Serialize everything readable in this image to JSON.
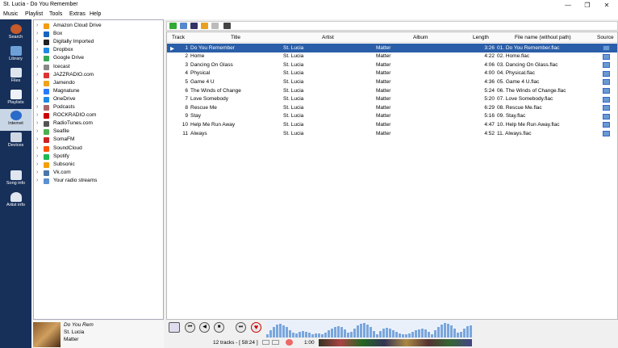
{
  "window": {
    "title": "St. Lucia - Do You Remember",
    "minimize": "—",
    "maximize": "❐",
    "close": "✕"
  },
  "menu": [
    "Music",
    "Playlist",
    "Tools",
    "Extras",
    "Help"
  ],
  "nav": [
    {
      "label": "Search"
    },
    {
      "label": "Library"
    },
    {
      "label": "Files"
    },
    {
      "label": "Playlists"
    },
    {
      "label": "Internet"
    },
    {
      "label": "Devices"
    },
    {
      "label": "Song info"
    },
    {
      "label": "Artist info"
    }
  ],
  "services": [
    "Amazon Cloud Drive",
    "Box",
    "Digitally Imported",
    "Dropbox",
    "Google Drive",
    "Icecast",
    "JAZZRADIO.com",
    "Jamendo",
    "Magnatune",
    "OneDrive",
    "Podcasts",
    "ROCKRADIO.com",
    "RadioTunes.com",
    "Seafile",
    "SomaFM",
    "SoundCloud",
    "Spotify",
    "Subsonic",
    "Vk.com",
    "Your radio streams"
  ],
  "service_icon_colors": [
    "#f39c12",
    "#1565c0",
    "#222",
    "#1e88e5",
    "#34a853",
    "#888",
    "#d33",
    "#f1a21b",
    "#2979ff",
    "#1e88e5",
    "#a66",
    "#c00",
    "#555",
    "#4caf50",
    "#c22",
    "#ff5500",
    "#1db954",
    "#f4a000",
    "#4a76a8",
    "#5a8fd0"
  ],
  "nowplaying": {
    "title": "Do You Rem",
    "artist": "St. Lucia",
    "album": "Matter"
  },
  "columns": {
    "track": "Track",
    "title": "Title",
    "artist": "Artist",
    "album": "Album",
    "length": "Length",
    "filename": "File name (without path)",
    "source": "Source"
  },
  "tracks": [
    {
      "n": "1",
      "title": "Do You Remember",
      "artist": "St. Lucia",
      "album": "Matter",
      "len": "3:26",
      "file": "01. Do You Remember.flac"
    },
    {
      "n": "2",
      "title": "Home",
      "artist": "St. Lucia",
      "album": "Matter",
      "len": "4:22",
      "file": "02. Home.flac"
    },
    {
      "n": "3",
      "title": "Dancing On Glass",
      "artist": "St. Lucia",
      "album": "Matter",
      "len": "4:06",
      "file": "03. Dancing On Glass.flac"
    },
    {
      "n": "4",
      "title": "Physical",
      "artist": "St. Lucia",
      "album": "Matter",
      "len": "4:00",
      "file": "04. Physical.flac"
    },
    {
      "n": "5",
      "title": "Game 4 U",
      "artist": "St. Lucia",
      "album": "Matter",
      "len": "4:36",
      "file": "05. Game 4 U.flac"
    },
    {
      "n": "6",
      "title": "The Winds of Change",
      "artist": "St. Lucia",
      "album": "Matter",
      "len": "5:24",
      "file": "06. The Winds of Change.flac"
    },
    {
      "n": "7",
      "title": "Love Somebody",
      "artist": "St. Lucia",
      "album": "Matter",
      "len": "5:20",
      "file": "07. Love Somebody.flac"
    },
    {
      "n": "8",
      "title": "Rescue Me",
      "artist": "St. Lucia",
      "album": "Matter",
      "len": "6:29",
      "file": "08. Rescue Me.flac"
    },
    {
      "n": "9",
      "title": "Stay",
      "artist": "St. Lucia",
      "album": "Matter",
      "len": "5:16",
      "file": "09. Stay.flac"
    },
    {
      "n": "10",
      "title": "Help Me Run Away",
      "artist": "St. Lucia",
      "album": "Matter",
      "len": "4:47",
      "file": "10. Help Me Run Away.flac"
    },
    {
      "n": "11",
      "title": "Always",
      "artist": "St. Lucia",
      "album": "Matter",
      "len": "4:52",
      "file": "11. Always.flac"
    }
  ],
  "status": {
    "tracks": "12 tracks - [ 58:24 ]",
    "position": "1:00"
  },
  "playback": {
    "playing_marker": "▶",
    "prev": "⏮",
    "play": "◀",
    "stop": "■",
    "next": "⏭",
    "love": "♥"
  }
}
